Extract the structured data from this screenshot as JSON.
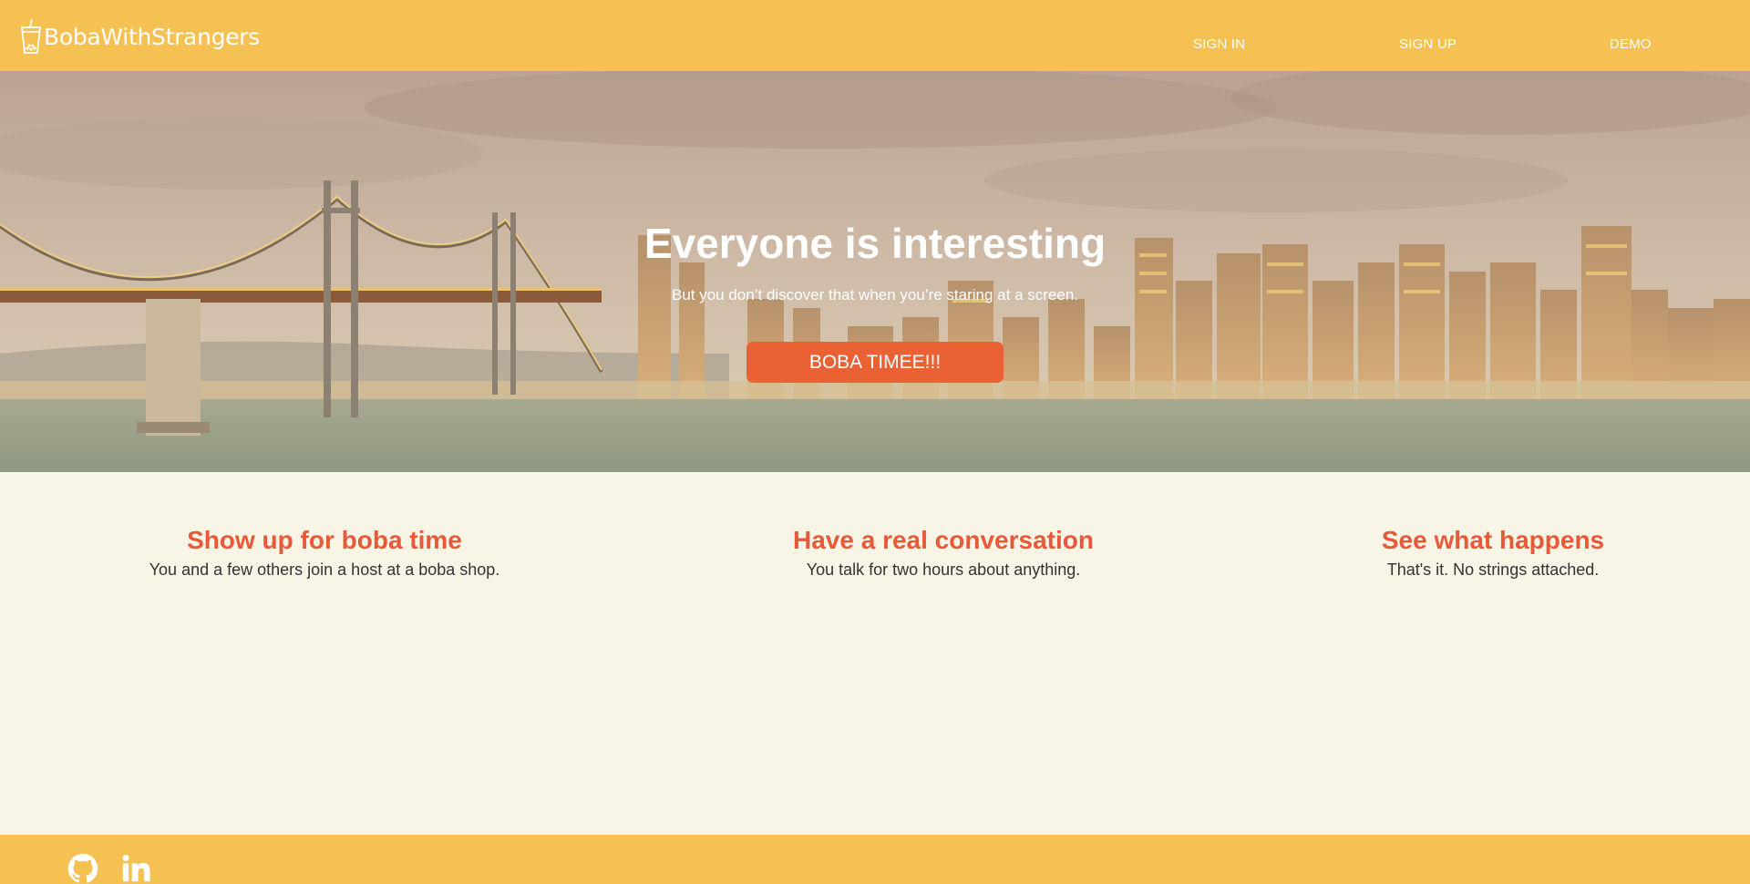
{
  "header": {
    "logo_text": "BobaWithStrangers",
    "logo_icon": "boba-cup-icon",
    "nav": {
      "sign_in": "SIGN IN",
      "sign_up": "SIGN UP",
      "demo": "DEMO"
    }
  },
  "hero": {
    "title": "Everyone is interesting",
    "subtitle": "But you don’t discover that when you’re staring at a screen.",
    "button": "BOBA TIMEE!!!"
  },
  "features": [
    {
      "title": "Show up for boba time",
      "description": "You and a few others join a host at a boba shop."
    },
    {
      "title": "Have a real conversation",
      "description": "You talk for two hours about anything."
    },
    {
      "title": "See what happens",
      "description": "That's it. No strings attached."
    }
  ],
  "footer": {
    "icons": [
      "github-icon",
      "linkedin-icon"
    ]
  },
  "colors": {
    "header_bg": "#f5c152",
    "button_bg": "#ea6234",
    "feature_title": "#e8593a",
    "page_bg": "#f8f4e6"
  }
}
